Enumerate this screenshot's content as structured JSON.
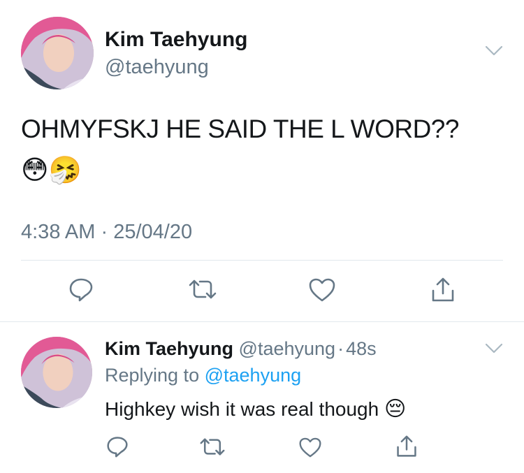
{
  "main_tweet": {
    "author_name": "Kim Taehyung",
    "handle": "@taehyung",
    "text": "OHMYFSKJ HE SAID THE L WORD??",
    "emojis": "😳🤧",
    "time": "4:38 AM",
    "date_sep": "·",
    "date": "25/04/20"
  },
  "reply_tweet": {
    "author_name": "Kim Taehyung",
    "handle": "@taehyung",
    "dot": "·",
    "age": "48s",
    "replying_prefix": "Replying to",
    "replying_to": "@taehyung",
    "text": "Highkey wish it was real though",
    "emoji": "😔"
  },
  "icons": [
    "chevron-down-icon",
    "reply-icon",
    "retweet-icon",
    "like-icon",
    "share-icon"
  ],
  "colors": {
    "text": "#14171a",
    "secondary": "#657786",
    "link": "#1da1f2",
    "divider": "#e1e8ed",
    "icon": "#657786"
  }
}
